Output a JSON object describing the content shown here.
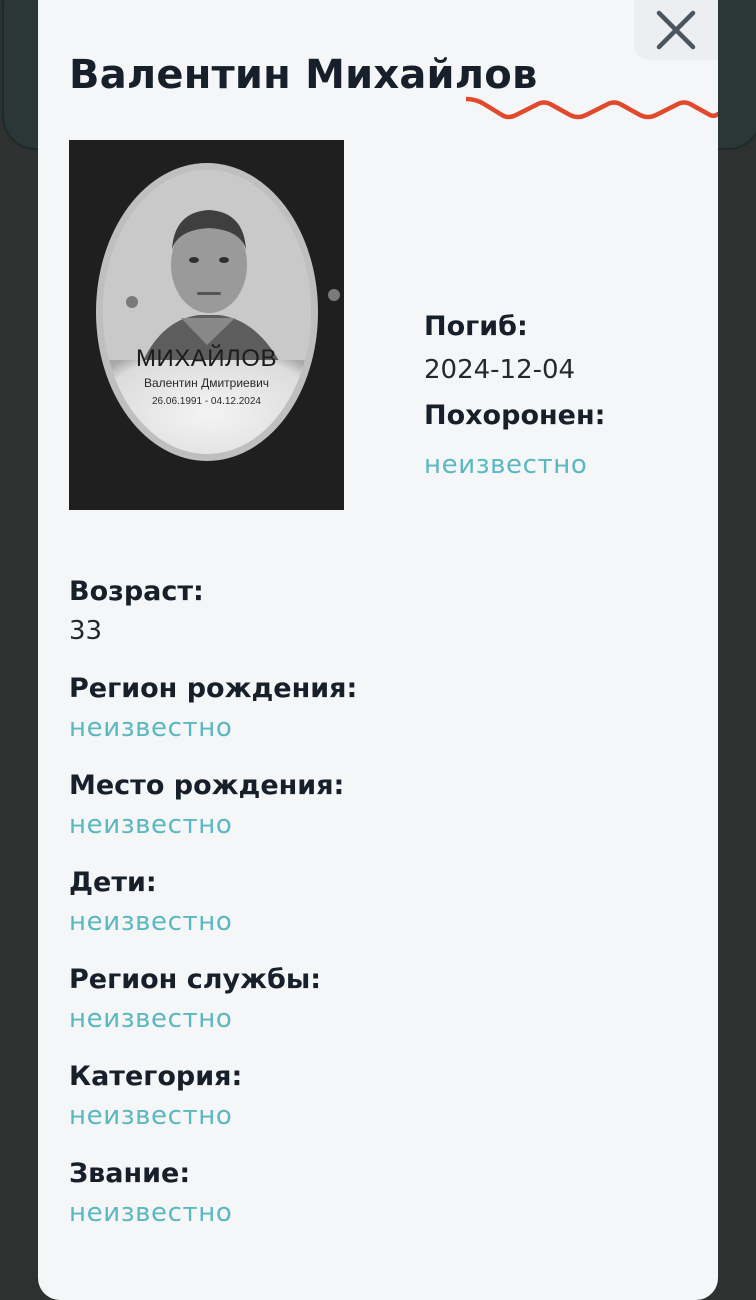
{
  "modal": {
    "title": "Валентин Михайлов",
    "close_label": "×",
    "accent_color": "#e0492c",
    "photo_alt": "Фото: Валентин Михайлов",
    "photo_plate": {
      "surname": "МИХАЙЛОВ",
      "given_names": "Валентин Дмитриевич",
      "dates": "26.06.1991 - 04.12.2024"
    },
    "side_fields": [
      {
        "label": "Погиб:",
        "value": "2024-12-04",
        "known": true
      },
      {
        "label": "Похоронен:",
        "value": "неизвестно",
        "known": false
      }
    ],
    "fields": [
      {
        "label": "Возраст:",
        "value": "33",
        "known": true
      },
      {
        "label": "Регион рождения:",
        "value": "неизвестно",
        "known": false
      },
      {
        "label": "Место рождения:",
        "value": "неизвестно",
        "known": false
      },
      {
        "label": "Дети:",
        "value": "неизвестно",
        "known": false
      },
      {
        "label": "Регион службы:",
        "value": "неизвестно",
        "known": false
      },
      {
        "label": "Категория:",
        "value": "неизвестно",
        "known": false
      },
      {
        "label": "Звание:",
        "value": "неизвестно",
        "known": false
      }
    ]
  }
}
